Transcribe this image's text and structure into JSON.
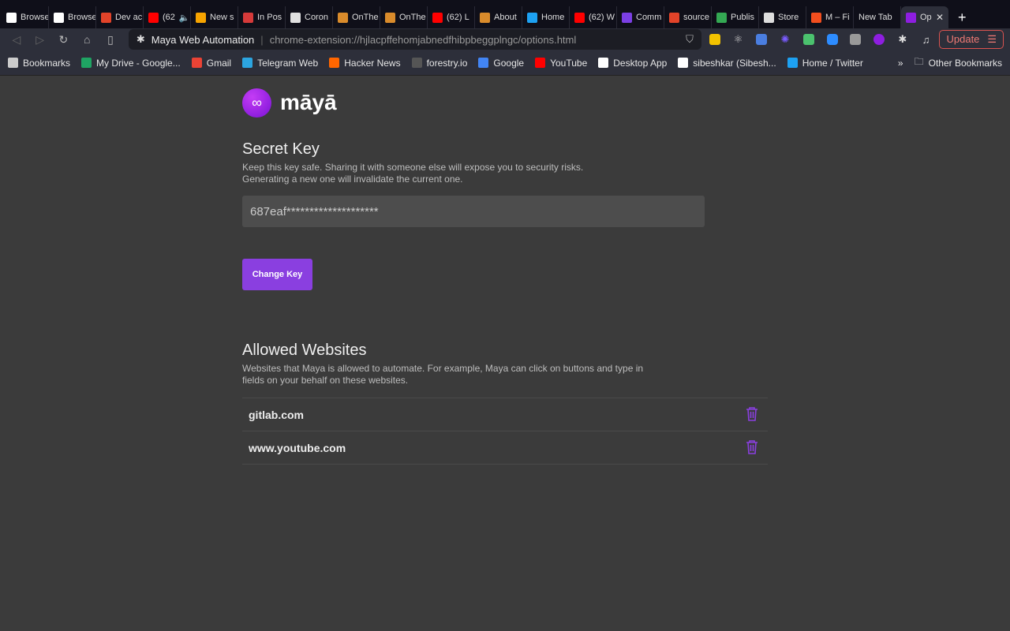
{
  "tabs": [
    {
      "title": "Browser",
      "icon": "notion-icon",
      "color": "#ffffff"
    },
    {
      "title": "Browser",
      "icon": "notion-icon",
      "color": "#ffffff"
    },
    {
      "title": "Dev ac",
      "icon": "gitlab-icon",
      "color": "#e24329"
    },
    {
      "title": "(62",
      "icon": "youtube-icon",
      "color": "#ff0000",
      "audio": true
    },
    {
      "title": "New s",
      "icon": "sunrise-icon",
      "color": "#f7a400"
    },
    {
      "title": "In Pos",
      "icon": "fs-icon",
      "color": "#d63a3a"
    },
    {
      "title": "Coron",
      "icon": "globe-icon",
      "color": "#e0e0e0"
    },
    {
      "title": "OnThe",
      "icon": "slash-icon",
      "color": "#d98b2b"
    },
    {
      "title": "OnThe",
      "icon": "slash-icon",
      "color": "#d98b2b"
    },
    {
      "title": "(62) L",
      "icon": "youtube-icon",
      "color": "#ff0000"
    },
    {
      "title": "About",
      "icon": "slash-icon",
      "color": "#d98b2b"
    },
    {
      "title": "Home",
      "icon": "twitter-icon",
      "color": "#1da1f2"
    },
    {
      "title": "(62) W",
      "icon": "youtube-icon",
      "color": "#ff0000"
    },
    {
      "title": "Comm",
      "icon": "dots-icon",
      "color": "#7b3fe4"
    },
    {
      "title": "source",
      "icon": "gitlab-icon",
      "color": "#e24329"
    },
    {
      "title": "Publis",
      "icon": "chrome-icon",
      "color": "#34a853"
    },
    {
      "title": "Store",
      "icon": "store-icon",
      "color": "#dddddd"
    },
    {
      "title": "M – Fi",
      "icon": "figma-icon",
      "color": "#f24e1e"
    },
    {
      "title": "New Tab",
      "icon": "",
      "color": ""
    },
    {
      "title": "Op",
      "icon": "maya-icon",
      "color": "#8e1ee0",
      "active": true
    }
  ],
  "toolbar": {
    "site_name": "Maya Web Automation",
    "url": "chrome-extension://hjlacpffehomjabnedfhibpbeggplngc/options.html",
    "update_label": "Update"
  },
  "bookmarks": [
    {
      "label": "Bookmarks",
      "icon": "bookmarks-icon",
      "color": "#cccccc"
    },
    {
      "label": "My Drive - Google...",
      "icon": "google-drive-icon",
      "color": "#1fa463"
    },
    {
      "label": "Gmail",
      "icon": "gmail-icon",
      "color": "#ea4335"
    },
    {
      "label": "Telegram Web",
      "icon": "telegram-icon",
      "color": "#2ca5e0"
    },
    {
      "label": "Hacker News",
      "icon": "hacker-news-icon",
      "color": "#ff6600"
    },
    {
      "label": "forestry.io",
      "icon": "forestry-icon",
      "color": "#555555"
    },
    {
      "label": "Google",
      "icon": "google-icon",
      "color": "#4285f4"
    },
    {
      "label": "YouTube",
      "icon": "youtube-icon",
      "color": "#ff0000"
    },
    {
      "label": "Desktop App",
      "icon": "notion-icon",
      "color": "#ffffff"
    },
    {
      "label": "sibeshkar (Sibesh...",
      "icon": "github-icon",
      "color": "#ffffff"
    },
    {
      "label": "Home / Twitter",
      "icon": "twitter-icon",
      "color": "#1da1f2"
    }
  ],
  "other_bookmarks": "Other Bookmarks",
  "brand": {
    "name": "māyā",
    "accent": "#8a3fe0"
  },
  "secret": {
    "title": "Secret Key",
    "desc1": "Keep this key safe. Sharing it with someone else will expose you to security risks.",
    "desc2": "Generating a new one will invalidate the current one.",
    "value": "687eaf********************",
    "button": "Change Key"
  },
  "allowed": {
    "title": "Allowed Websites",
    "desc": "Websites that Maya is allowed to automate. For example, Maya can click on buttons and type in fields on your behalf on these websites.",
    "sites": [
      "gitlab.com",
      "www.youtube.com"
    ]
  }
}
